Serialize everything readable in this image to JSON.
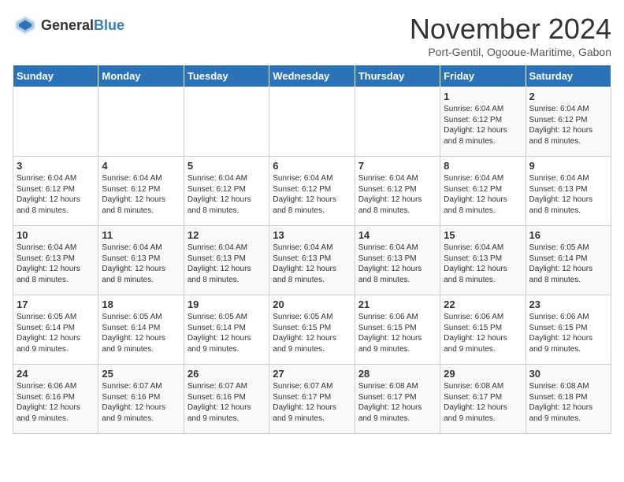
{
  "header": {
    "logo_general": "General",
    "logo_blue": "Blue",
    "title": "November 2024",
    "subtitle": "Port-Gentil, Ogooue-Maritime, Gabon"
  },
  "days_of_week": [
    "Sunday",
    "Monday",
    "Tuesday",
    "Wednesday",
    "Thursday",
    "Friday",
    "Saturday"
  ],
  "weeks": [
    [
      {
        "day": "",
        "text": ""
      },
      {
        "day": "",
        "text": ""
      },
      {
        "day": "",
        "text": ""
      },
      {
        "day": "",
        "text": ""
      },
      {
        "day": "",
        "text": ""
      },
      {
        "day": "1",
        "text": "Sunrise: 6:04 AM\nSunset: 6:12 PM\nDaylight: 12 hours and 8 minutes."
      },
      {
        "day": "2",
        "text": "Sunrise: 6:04 AM\nSunset: 6:12 PM\nDaylight: 12 hours and 8 minutes."
      }
    ],
    [
      {
        "day": "3",
        "text": "Sunrise: 6:04 AM\nSunset: 6:12 PM\nDaylight: 12 hours and 8 minutes."
      },
      {
        "day": "4",
        "text": "Sunrise: 6:04 AM\nSunset: 6:12 PM\nDaylight: 12 hours and 8 minutes."
      },
      {
        "day": "5",
        "text": "Sunrise: 6:04 AM\nSunset: 6:12 PM\nDaylight: 12 hours and 8 minutes."
      },
      {
        "day": "6",
        "text": "Sunrise: 6:04 AM\nSunset: 6:12 PM\nDaylight: 12 hours and 8 minutes."
      },
      {
        "day": "7",
        "text": "Sunrise: 6:04 AM\nSunset: 6:12 PM\nDaylight: 12 hours and 8 minutes."
      },
      {
        "day": "8",
        "text": "Sunrise: 6:04 AM\nSunset: 6:12 PM\nDaylight: 12 hours and 8 minutes."
      },
      {
        "day": "9",
        "text": "Sunrise: 6:04 AM\nSunset: 6:13 PM\nDaylight: 12 hours and 8 minutes."
      }
    ],
    [
      {
        "day": "10",
        "text": "Sunrise: 6:04 AM\nSunset: 6:13 PM\nDaylight: 12 hours and 8 minutes."
      },
      {
        "day": "11",
        "text": "Sunrise: 6:04 AM\nSunset: 6:13 PM\nDaylight: 12 hours and 8 minutes."
      },
      {
        "day": "12",
        "text": "Sunrise: 6:04 AM\nSunset: 6:13 PM\nDaylight: 12 hours and 8 minutes."
      },
      {
        "day": "13",
        "text": "Sunrise: 6:04 AM\nSunset: 6:13 PM\nDaylight: 12 hours and 8 minutes."
      },
      {
        "day": "14",
        "text": "Sunrise: 6:04 AM\nSunset: 6:13 PM\nDaylight: 12 hours and 8 minutes."
      },
      {
        "day": "15",
        "text": "Sunrise: 6:04 AM\nSunset: 6:13 PM\nDaylight: 12 hours and 8 minutes."
      },
      {
        "day": "16",
        "text": "Sunrise: 6:05 AM\nSunset: 6:14 PM\nDaylight: 12 hours and 8 minutes."
      }
    ],
    [
      {
        "day": "17",
        "text": "Sunrise: 6:05 AM\nSunset: 6:14 PM\nDaylight: 12 hours and 9 minutes."
      },
      {
        "day": "18",
        "text": "Sunrise: 6:05 AM\nSunset: 6:14 PM\nDaylight: 12 hours and 9 minutes."
      },
      {
        "day": "19",
        "text": "Sunrise: 6:05 AM\nSunset: 6:14 PM\nDaylight: 12 hours and 9 minutes."
      },
      {
        "day": "20",
        "text": "Sunrise: 6:05 AM\nSunset: 6:15 PM\nDaylight: 12 hours and 9 minutes."
      },
      {
        "day": "21",
        "text": "Sunrise: 6:06 AM\nSunset: 6:15 PM\nDaylight: 12 hours and 9 minutes."
      },
      {
        "day": "22",
        "text": "Sunrise: 6:06 AM\nSunset: 6:15 PM\nDaylight: 12 hours and 9 minutes."
      },
      {
        "day": "23",
        "text": "Sunrise: 6:06 AM\nSunset: 6:15 PM\nDaylight: 12 hours and 9 minutes."
      }
    ],
    [
      {
        "day": "24",
        "text": "Sunrise: 6:06 AM\nSunset: 6:16 PM\nDaylight: 12 hours and 9 minutes."
      },
      {
        "day": "25",
        "text": "Sunrise: 6:07 AM\nSunset: 6:16 PM\nDaylight: 12 hours and 9 minutes."
      },
      {
        "day": "26",
        "text": "Sunrise: 6:07 AM\nSunset: 6:16 PM\nDaylight: 12 hours and 9 minutes."
      },
      {
        "day": "27",
        "text": "Sunrise: 6:07 AM\nSunset: 6:17 PM\nDaylight: 12 hours and 9 minutes."
      },
      {
        "day": "28",
        "text": "Sunrise: 6:08 AM\nSunset: 6:17 PM\nDaylight: 12 hours and 9 minutes."
      },
      {
        "day": "29",
        "text": "Sunrise: 6:08 AM\nSunset: 6:17 PM\nDaylight: 12 hours and 9 minutes."
      },
      {
        "day": "30",
        "text": "Sunrise: 6:08 AM\nSunset: 6:18 PM\nDaylight: 12 hours and 9 minutes."
      }
    ]
  ]
}
